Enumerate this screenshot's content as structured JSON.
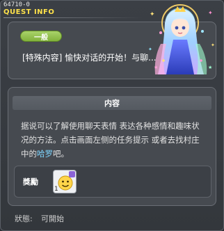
{
  "window": {
    "quest_id": "64710-0",
    "title": "QUEST INFO"
  },
  "quest": {
    "category": "一般",
    "name": "[特殊内容] 愉快对话的开始！与聊..."
  },
  "content": {
    "header": "内容",
    "description_part1": "据说可以了解使用聊天表情 表达各种感情和趣味状况的方法。点击画面左侧的任务提示 或者去找村庄中的",
    "npc_name": "哈罗",
    "description_part2": "吧。"
  },
  "reward": {
    "label": "獎勵",
    "item_icon": "smiley-emoticon-icon",
    "item_count": "1"
  },
  "status": {
    "label": "狀態:",
    "value": "可開始"
  },
  "colors": {
    "title": "#ffe24a",
    "badge": "#94c44f",
    "npc_highlight": "#7fd6ff"
  }
}
